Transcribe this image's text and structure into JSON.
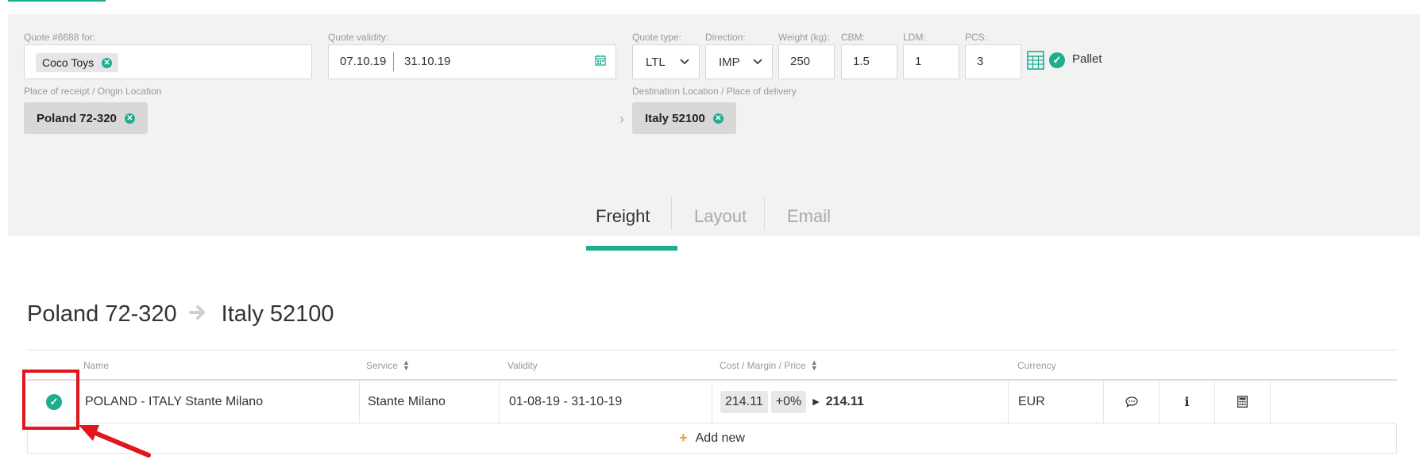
{
  "quote": {
    "for_label": "Quote #6688 for:",
    "customer": "Coco Toys",
    "validity_label": "Quote validity:",
    "validity_from": "07.10.19",
    "validity_to": "31.10.19",
    "type_label": "Quote type:",
    "type_value": "LTL",
    "direction_label": "Direction:",
    "direction_value": "IMP",
    "weight_label": "Weight (kg):",
    "weight_value": "250",
    "cbm_label": "CBM:",
    "cbm_value": "1.5",
    "ldm_label": "LDM:",
    "ldm_value": "1",
    "pcs_label": "PCS:",
    "pcs_value": "3",
    "pallet_label": "Pallet",
    "origin_label": "Place of receipt / Origin Location",
    "origin_value": "Poland 72-320",
    "dest_label": "Destination Location / Place of delivery",
    "dest_value": "Italy 52100"
  },
  "tabs": [
    {
      "label": "Freight"
    },
    {
      "label": "Layout"
    },
    {
      "label": "Email"
    }
  ],
  "route": {
    "from": "Poland 72-320",
    "to": "Italy 52100"
  },
  "table": {
    "headers": {
      "name": "Name",
      "service": "Service",
      "validity": "Validity",
      "cost": "Cost / Margin / Price",
      "currency": "Currency"
    },
    "rows": [
      {
        "name": "POLAND - ITALY Stante Milano",
        "service": "Stante Milano",
        "validity": "01-08-19 - 31-10-19",
        "cost": "214.11",
        "margin": "+0%",
        "price": "214.11",
        "currency": "EUR"
      }
    ],
    "add_new": "Add new"
  },
  "colors": {
    "accent": "#1fad8f",
    "highlight": "#e0161c",
    "plus": "#f0a030"
  }
}
